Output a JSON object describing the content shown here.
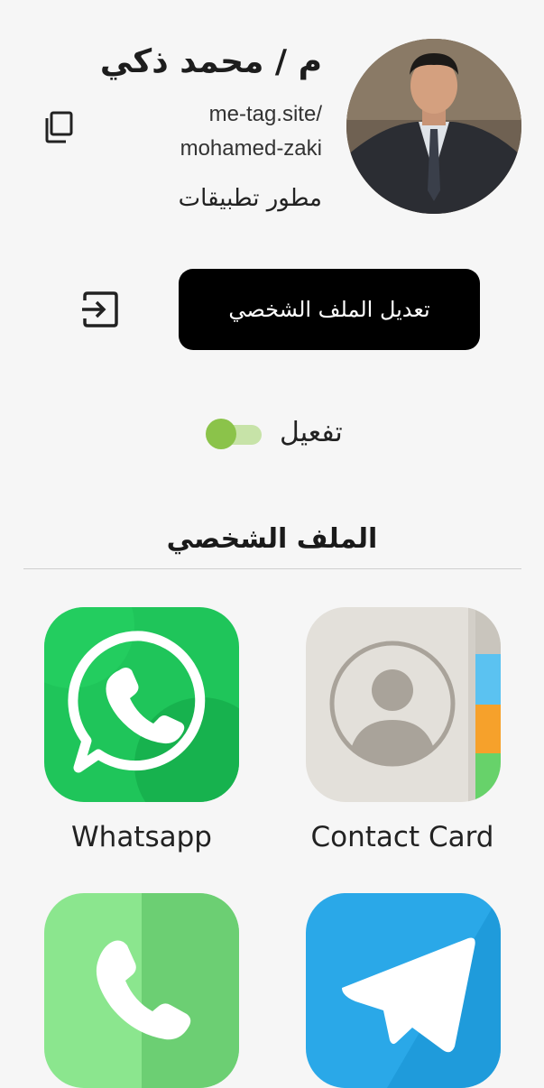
{
  "profile": {
    "name": "م / محمد ذكي",
    "link_line1": "me-tag.site/",
    "link_line2": "mohamed-zaki",
    "job_title": "مطور تطبيقات"
  },
  "actions": {
    "edit_profile_label": "تعديل الملف الشخصي",
    "activate_label": "تفعيل",
    "activate_on": true
  },
  "section": {
    "title": "الملف الشخصي"
  },
  "apps": [
    {
      "label": "Contact Card",
      "icon": "contact-card-icon"
    },
    {
      "label": "Whatsapp",
      "icon": "whatsapp-icon"
    },
    {
      "label": "",
      "icon": "telegram-icon"
    },
    {
      "label": "",
      "icon": "phone-icon"
    }
  ],
  "colors": {
    "button_bg": "#000000",
    "toggle_knob": "#8bc34a",
    "toggle_track": "#c7e3a8",
    "whatsapp_green": "#1fc55a",
    "telegram_blue": "#2aa8e8",
    "phone_green": "#74d67c"
  }
}
